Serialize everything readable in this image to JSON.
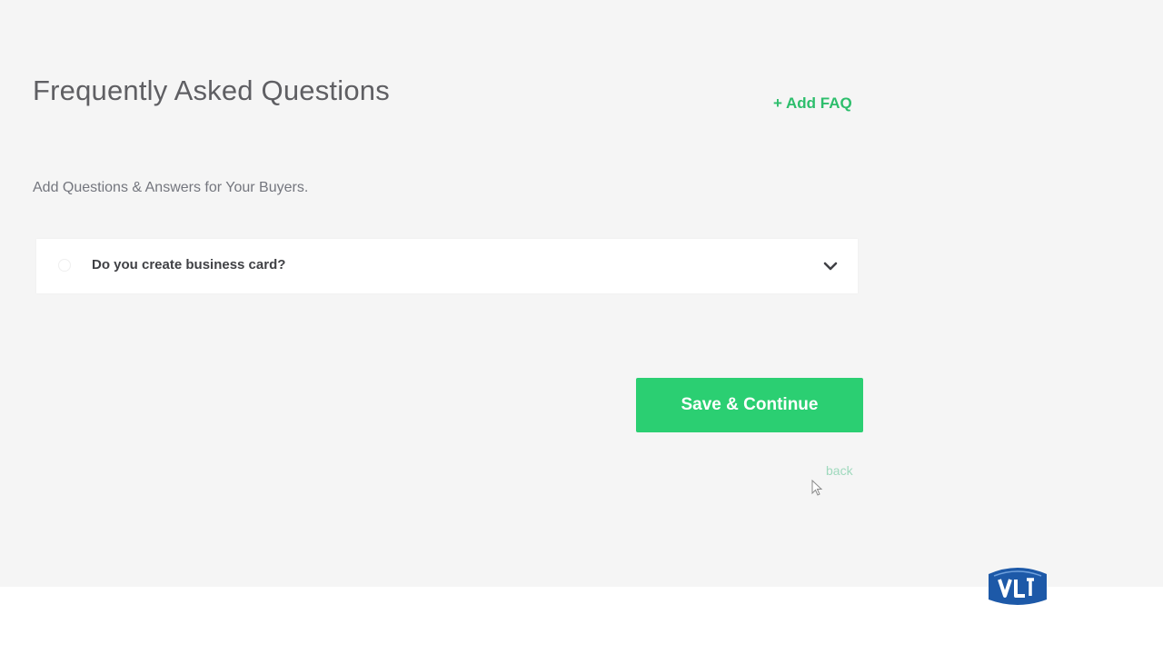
{
  "header": {
    "title": "Frequently Asked Questions",
    "add_faq_label": "+ Add FAQ"
  },
  "subtitle": "Add Questions & Answers for Your Buyers.",
  "faqs": [
    {
      "question": "Do you create business card?"
    }
  ],
  "actions": {
    "save_label": "Save & Continue",
    "back_label": "back"
  },
  "icons": {
    "chevron": "chevron-down-icon",
    "cursor": "mouse-cursor-icon",
    "logo": "logo-icon"
  },
  "colors": {
    "accent": "#2bcf72",
    "link": "#2dbe6c",
    "title": "#5f5f63",
    "logo_blue": "#1d59a8"
  }
}
